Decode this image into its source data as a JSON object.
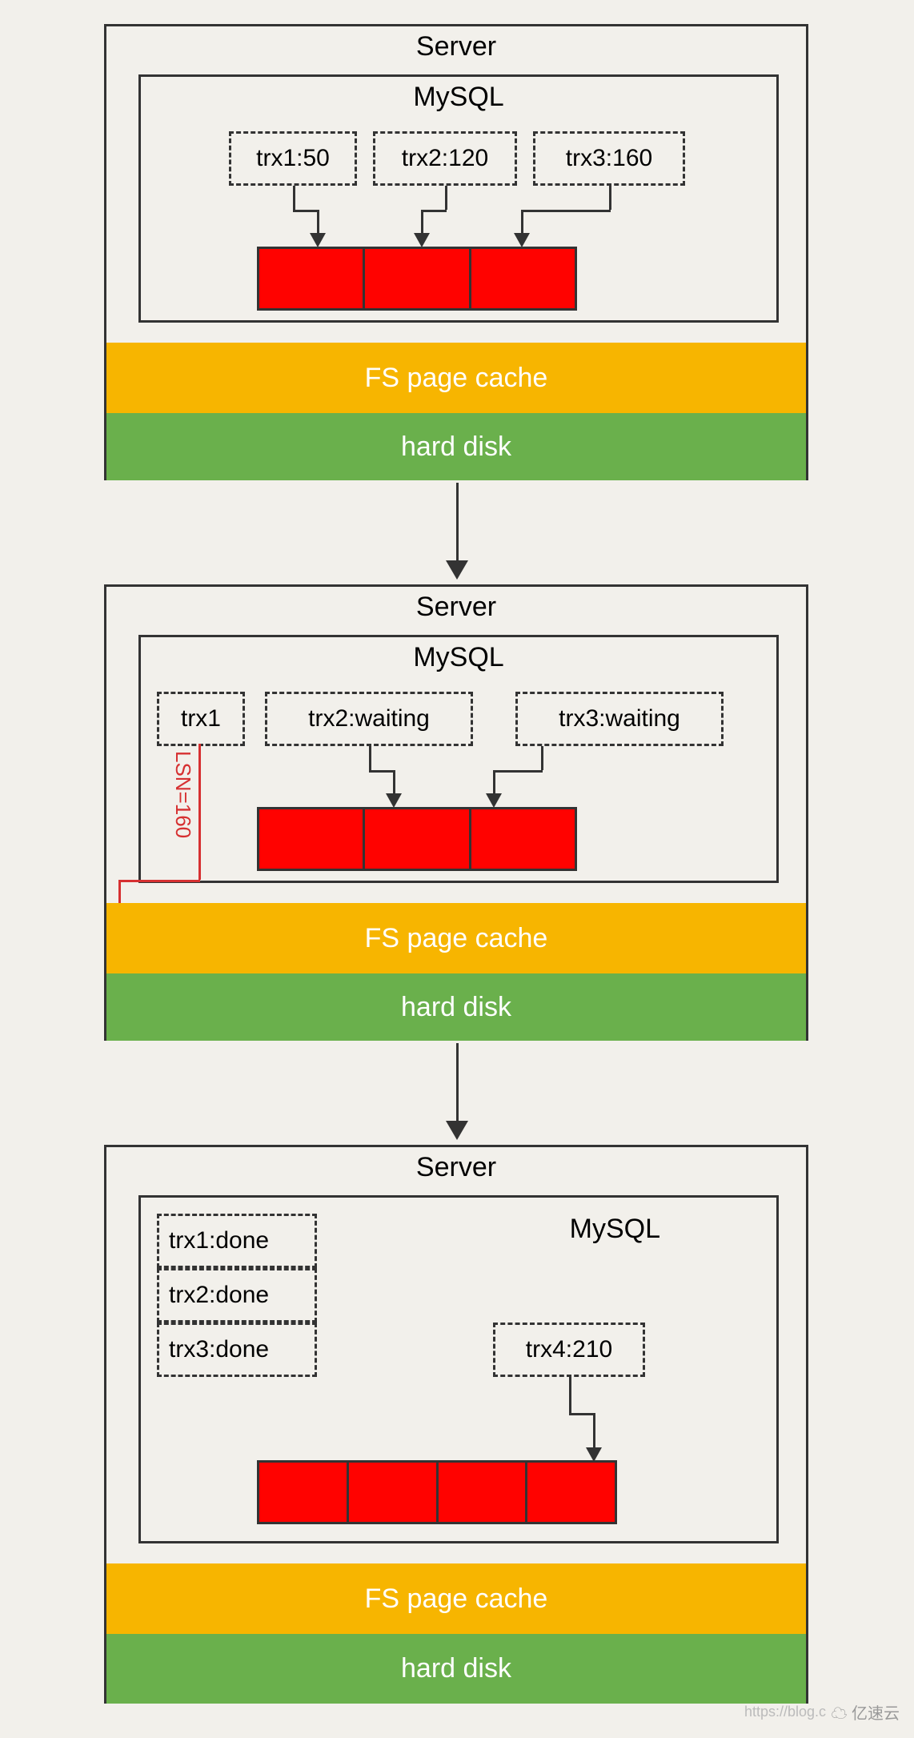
{
  "colors": {
    "red": "#ff0200",
    "orange": "#f7b500",
    "green": "#6ab04c"
  },
  "labels": {
    "server": "Server",
    "mysql": "MySQL",
    "fs_cache": "FS page cache",
    "hard_disk": "hard disk"
  },
  "stage1": {
    "trx1": "trx1:50",
    "trx2": "trx2:120",
    "trx3": "trx3:160"
  },
  "stage2": {
    "trx1": "trx1",
    "trx2": "trx2:waiting",
    "trx3": "trx3:waiting",
    "lsn": "LSN=160"
  },
  "stage3": {
    "trx1": "trx1:done",
    "trx2": "trx2:done",
    "trx3": "trx3:done",
    "trx4": "trx4:210"
  },
  "watermark": "亿速云",
  "watermark_url": "https://blog.c"
}
